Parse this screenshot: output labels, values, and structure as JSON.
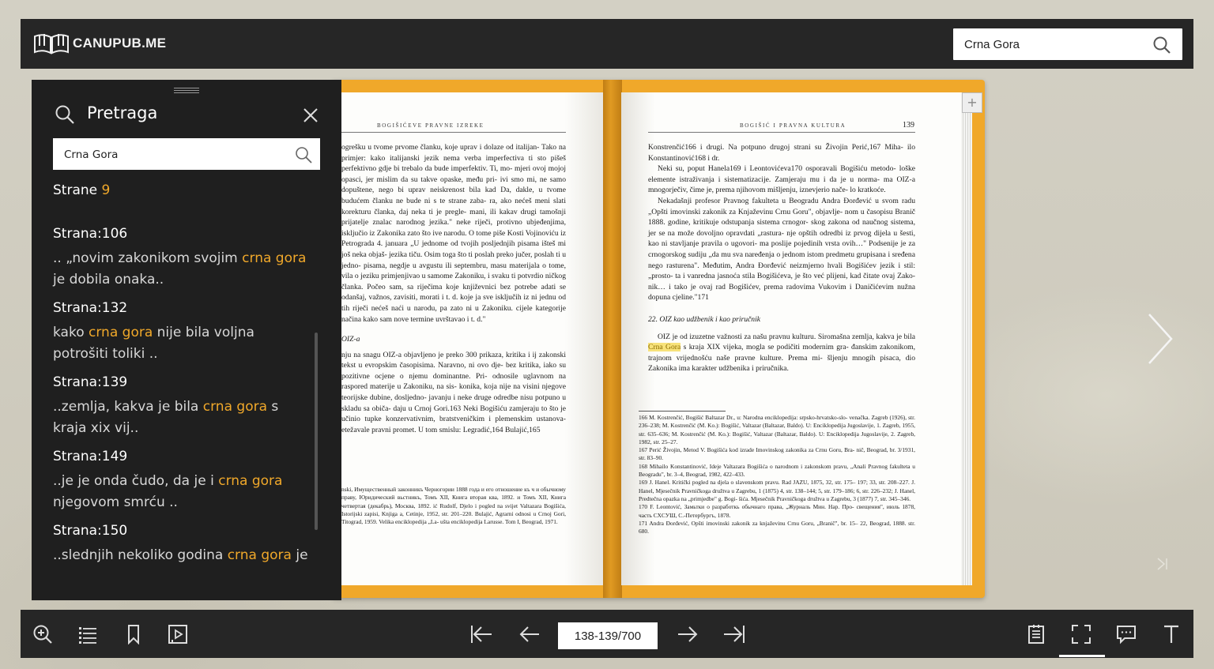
{
  "app": {
    "logo_text": "CANUPUB.ME",
    "search_value": "Crna Gora"
  },
  "panel": {
    "title": "Pretraga",
    "input_value": "Crna Gora",
    "count_label": "Strane",
    "count_value": "9",
    "results": [
      {
        "page": "Strana:106",
        "pre": ".. „novim zakonikom svojim ",
        "kw": "crna gora",
        "post": " je dobila onaka.."
      },
      {
        "page": "Strana:132",
        "pre": "kako ",
        "kw": "crna gora",
        "post": " nije bila voljna potrošiti toliki .."
      },
      {
        "page": "Strana:139",
        "pre": "..zemlja, kakva je bila ",
        "kw": "crna gora",
        "post": " s kraja xix vij.."
      },
      {
        "page": "Strana:149",
        "pre": "..je je onda čudo, da je i ",
        "kw": "crna gora",
        "post": " njegovom smrću .."
      },
      {
        "page": "Strana:150",
        "pre": "..slednjih nekoliko godina ",
        "kw": "crna gora",
        "post": " je"
      }
    ]
  },
  "left_page": {
    "running_head": "BOGIŠIĆEVE PRAVNE IZREKE",
    "paragraphs": [
      "ogrešku u tvome prvome članku, koje uprav i dolaze od italijan- Tako na primjer: kako italijanski jezik nema verba imperfectiva ti sto pišeš perfektivno gdje bi trebalo da bude imperfektiv. Ti, mo- mjeri ovoj mojoj opasci, jer mislim da su takve opaske, među pri- ivi smo mi, ne samo dopuštene, nego bi uprav neiskrenost bila kad Da, dakle, u tvome budućem članku ne bude ni s te strane zaba- ra, ako nećeš meni slati korekturu članka, daj neka ti je pregle- mani, ili kakav drugi tamošnji prijatelje znalac narodnog jezika.\" neke riječi, protivno ubjeđenjima, isključio iz Zakonika zato što ive narodu. O tome piše Kosti Vojinoviću iz Petrograda 4. januara „U jednome od tvojih posljednjih pisama išteš mi još neka objaš- jezika tiču. Osim toga što ti poslah preko jučer, poslah ti u jedno- pisama, negdje u avgustu ili septembru, masu materijala o tome, vila o jeziku primjenjivao u samome Zakoniku, i svaku ti potvrdio ničkog članka. Počeo sam, sa riječima koje književnici bez potrebe adati se odanšaj, važnos, zavisiti, morati i t. d. koje ja sve isključih iz ni jednu od tih riječi nećeš naći u narodu, pa zato ni u Zakoniku. cijele kategorije načina kako sam nove termine uvrštavao i t. d.\""
    ],
    "section": "OIZ-a",
    "paragraphs2": [
      "nju na snagu OIZ-a objavljeno je preko 300 prikaza, kritika i ij zakonski tekst u evropskim časopisima. Naravno, ni ovo dje- bez kritika, iako su pozitivne ocjene o njemu dominantne. Pri- odnosile uglavnom na raspored materije u Zakoniku, na sis- konika, koja nije na visini njegove teorijske dubine, dosljedno- javanju i neke druge odredbe nisu potpuno u skladu sa običa- daju u Crnoj Gori.163 Neki Bogišiću zamjeraju to što je učinio tupke konzervativnim, bratstveničkim i plemenskim ustanova- etežavale pravni promet. U tom smislu: Legradić,164 Bulajić,165"
    ],
    "notes": "nski, Имущественный законникъ Черногории 1888 года и его отношение къ ч и обычному праву, Юридический вьстникъ, Томъ XII, Книга вторая ква, 1892. и Томъ XII, Книга четвертая (декабрь), Москва, 1892. ić Rudolf, Djelo i pogled na svijet Valtazara Bogišića, Istorijski zapisi, Knjiga a, Cetinje, 1952, str. 201–220. Bulajić, Agrarni odnosi u Crnoj Gori, Titograd, 1959. Velika enciklopedija „La- ušta enciklopedija Larusse. Tom I, Beograd, 1971."
  },
  "right_page": {
    "running_head": "BOGIŠIĆ I PRAVNA KULTURA",
    "number": "139",
    "paragraphs": [
      "Konstrenčić166 i drugi. Na potpuno drugoj strani su Živojin Perić,167 Miha- ilo Konstantinović168 i dr.",
      "Neki su, poput Hanela169 i Leontovićeva170 osporavali Bogišiću metodo- loške elemente istraživanja i sistematizacije. Zamjeraju mu i da je u norma- ma OIZ-a mnogorječiv, čime je, prema njihovom mišljenju, iznevjerio nače- lo kratkoće.",
      "Nekadašnji profesor Pravnog fakulteta u Beogradu Andra Đorđević u svom radu „Opšti imovinski zakonik za Knjaževinu Crnu Goru\", objavlje- nom u časopisu Branič 1888. godine, kritikuje odstupanja sistema crnogor- skog zakona od naučnog sistema, jer se na može dovoljno opravdati „rastura- nje opštih odredbi iz prvog dijela u šesti, kao ni stavljanje pravila o ugovori- ma poslije pojedinih vrsta ovih…\" Podsenije je za crnogorskog sudiju „da mu sva naređenja o jednom istom predmetu grupisana i sređena nego rasturena\". Međutim, Andra Đorđević neizmjerno hvali Bogišićev jezik i stil: „prosto- ta i vanredna jasnoća stila Bogišićeva, je što već plijeni, kad čitate ovaj Zako- nik… i tako je ovaj rad Bogišićev, prema radovima Vukovim i Daničićevim nužna dopuna cjeline.\"171"
    ],
    "section": "22. OIZ kao udžbenik i kao priručnik",
    "p2_pre": "OIZ je od izuzetne važnosti za našu pravnu kulturu. Siromašna zemlja, kakva je bila ",
    "p2_hl": "Crna Gora",
    "p2_post": " s kraja XIX vijeka, mogla se podičiti modernim gra- đanskim zakonikom, trajnom vrijednošću naše pravne kulture. Prema mi- šljenju mnogih pisaca, dio Zakonika ima karakter udžbenika i priručnika.",
    "notes": [
      "166 M. Kostrenčić, Bogišić Baltazar Dr., u: Narodna enciklopedija: srpsko-hrvatsko-slo- venačka. Zagreb (1926), str. 236–238; M. Kostrenčić (M. Ko.): Bogišić, Valtazar (Baltazar, Baldo). U: Enciklopedija Jugoslavije, 1. Zagreb, 1955, str. 635–636; M. Kostrenčić (M. Ko.): Bogišić, Valtazar (Baltazar, Baldo). U: Enciklopedija Jugoslavije, 2. Zagreb, 1982, str. 25–27.",
      "167 Perić Živojin, Metod V. Bogišića kod izrade Imovinskog zakonika za Crnu Goru, Bra- nič, Beograd, br. 3/1931, str. 83–90.",
      "168 Mihailo Konstantinović, Ideje Valtazara Bogišića o narodnom i zakonskom pravu, „Anali Pravnog fakulteta u Beogradu\", br. 3–4, Beograd, 1982, 422–433.",
      "169 J. Hanel. Kritički pogled na djela o slavenskom pravu. Rad JAZU, 1875, 32, str. 175– 197; 33, str. 208–227. J. Hanel, Mjesečnik Pravničkoga družtva u Zagrebu, 1 (1875) 4, str. 138–144; 5, str. 179–186; 6, str. 226–232; J. Hanel, Predtečna opazka na „primjedbe\" g. Bogi- šića. Mjesečnik Pravničkoga družtva u Zagrebu, 3 (1877) 7, str. 345–346.",
      "170 F. Leontović, Замьтки о разработкь обычнаго права, „Журналь Мин. Нар. Про- свещения\", июль 1878, часть CXCУШ, С.-Петербургъ, 1878.",
      "171 Andra Đorđević, Opšti imovinski zakonik za knjaževinu Crnu Goru, „Branič\", br. 15– 22, Beograd, 1888. str. 680."
    ]
  },
  "pager": {
    "value": "138-139/700"
  },
  "icons": {
    "toolbar_left": [
      "zoom-in-icon",
      "table-of-contents-icon",
      "bookmark-icon",
      "slideshow-icon"
    ],
    "nav": [
      "first-page-icon",
      "prev-page-icon",
      "next-page-icon",
      "last-page-icon"
    ],
    "toolbar_right": [
      "notes-icon",
      "fullscreen-icon",
      "comments-icon",
      "text-icon"
    ]
  },
  "colors": {
    "accent": "#f0a82a",
    "bar": "#262626",
    "panel": "#1f1f1f"
  }
}
